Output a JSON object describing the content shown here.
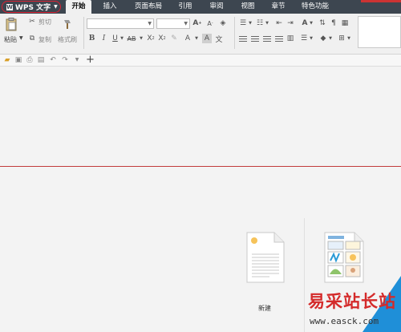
{
  "menubar": {
    "app_button": "WPS 文字",
    "tabs": [
      "开始",
      "插入",
      "页面布局",
      "引用",
      "审阅",
      "视图",
      "章节",
      "特色功能"
    ]
  },
  "ribbon": {
    "paste_label": "粘贴",
    "cut_label": "剪切",
    "copy_label": "复制",
    "format_painter_label": "格式刷",
    "font_name": "",
    "font_size": ""
  },
  "templates": {
    "new_label": "新建"
  },
  "watermark": {
    "text": "易采站长站",
    "url": "www.easck.com"
  },
  "colors": {
    "menubar_bg": "#3d4650",
    "accent_red": "#d23030",
    "watermark_blue": "#1f8fd8"
  }
}
